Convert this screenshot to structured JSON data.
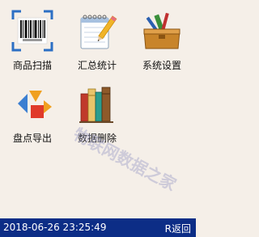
{
  "menu": {
    "items": [
      {
        "label": "商品扫描",
        "icon": "barcode-scan-icon"
      },
      {
        "label": "汇总统计",
        "icon": "notepad-pencil-icon"
      },
      {
        "label": "系统设置",
        "icon": "toolbox-icon"
      },
      {
        "label": "盘点导出",
        "icon": "shapes-export-icon"
      },
      {
        "label": "数据删除",
        "icon": "books-icon"
      }
    ]
  },
  "watermark": "物联网数据之家",
  "statusbar": {
    "datetime": "2018-06-26 23:25:49",
    "back_label": "R返回"
  },
  "colors": {
    "statusbar_bg": "#0c2d86",
    "page_bg": "#f5efe8"
  }
}
